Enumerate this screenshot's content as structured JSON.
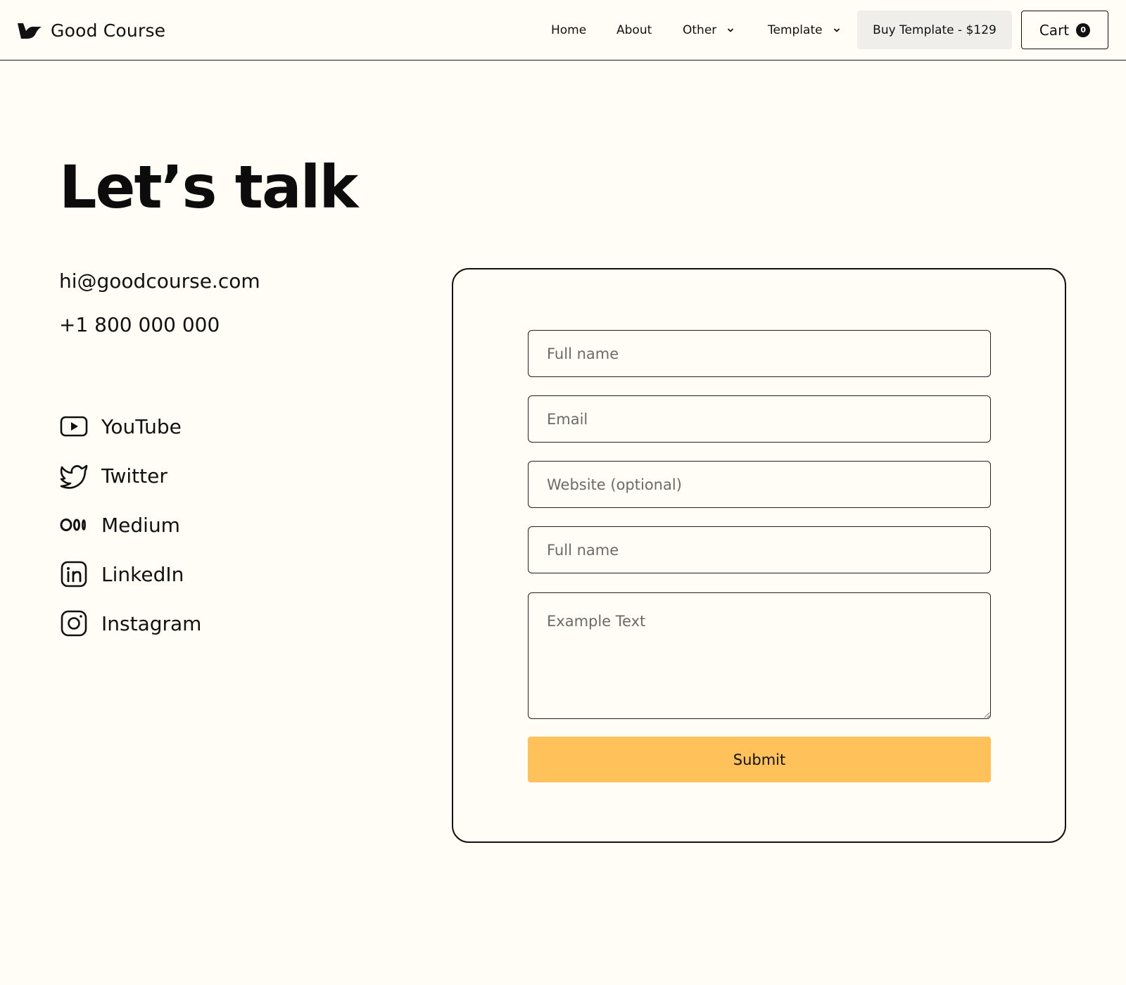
{
  "brand": {
    "name": "Good Course"
  },
  "nav": {
    "home": "Home",
    "about": "About",
    "other": "Other",
    "template": "Template",
    "buy_label": "Buy Template - $129",
    "cart_label": "Cart",
    "cart_count": "0"
  },
  "hero": {
    "title": "Let’s talk"
  },
  "contact": {
    "email": "hi@goodcourse.com",
    "phone": "+1 800 000 000"
  },
  "social": [
    {
      "label": "YouTube",
      "icon": "youtube-icon"
    },
    {
      "label": "Twitter",
      "icon": "twitter-icon"
    },
    {
      "label": "Medium",
      "icon": "medium-icon"
    },
    {
      "label": "LinkedIn",
      "icon": "linkedin-icon"
    },
    {
      "label": "Instagram",
      "icon": "instagram-icon"
    }
  ],
  "form": {
    "full_name_placeholder": "Full name",
    "email_placeholder": "Email",
    "website_placeholder": "Website (optional)",
    "full_name_2_placeholder": "Full name",
    "message_placeholder": "Example Text",
    "submit_label": "Submit"
  },
  "colors": {
    "background": "#fffdf5",
    "accent": "#ffc159",
    "button_secondary": "#efeeea",
    "text": "#111111"
  }
}
